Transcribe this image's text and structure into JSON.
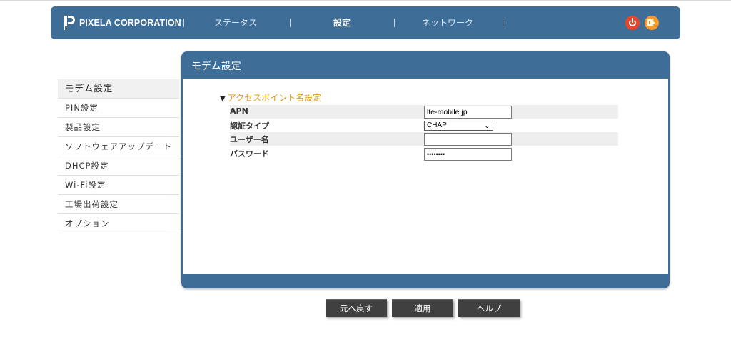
{
  "header": {
    "logo_text": "PIXELA CORPORATION",
    "nav": [
      "ステータス",
      "設定",
      "ネットワーク"
    ],
    "active_nav": "設定",
    "icons": [
      "power-icon",
      "logout-icon"
    ],
    "colors": {
      "bar": "#3e6d97",
      "power": "#e8452a",
      "logout": "#f39a2a"
    }
  },
  "sidebar": {
    "items": [
      {
        "label": "モデム設定",
        "active": true
      },
      {
        "label": "PIN設定"
      },
      {
        "label": "製品設定"
      },
      {
        "label": "ソフトウェアアップデート"
      },
      {
        "label": "DHCP設定"
      },
      {
        "label": "Wi-Fi設定"
      },
      {
        "label": "工場出荷設定"
      },
      {
        "label": "オプション"
      }
    ]
  },
  "panel": {
    "title": "モデム設定",
    "section_title": "アクセスポイント名設定",
    "fields": [
      {
        "label": "APN",
        "value": "lte-mobile.jp"
      },
      {
        "label": "認証タイプ",
        "value": "CHAP"
      },
      {
        "label": "ユーザー名",
        "value": ""
      },
      {
        "label": "パスワード",
        "value": "••••••••"
      }
    ]
  },
  "buttons": {
    "back": "元へ戻す",
    "apply": "適用",
    "help": "ヘルプ"
  }
}
